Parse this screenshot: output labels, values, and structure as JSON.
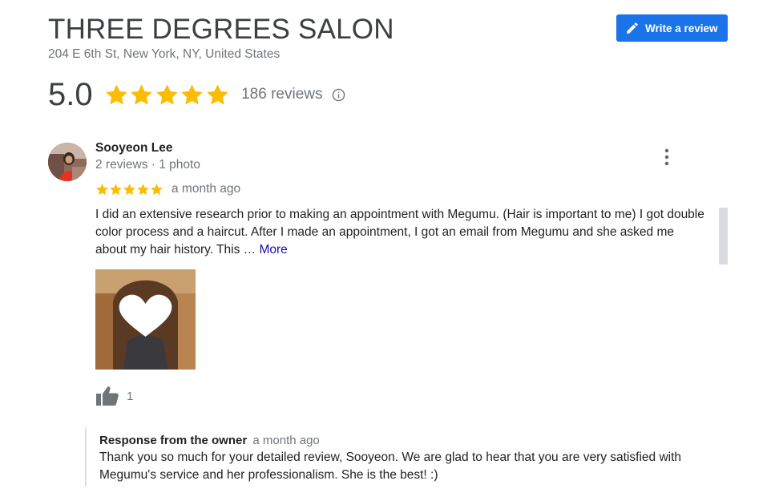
{
  "business": {
    "name": "THREE DEGREES SALON",
    "address": "204 E 6th St, New York, NY, United States",
    "rating": "5.0",
    "stars": 5,
    "reviews_label": "186 reviews"
  },
  "actions": {
    "write_review_label": "Write a review"
  },
  "colors": {
    "accent": "#1a73e8",
    "star": "#fbbc04",
    "link": "#1a0dab",
    "secondary_text": "#70757a"
  },
  "review": {
    "author": "Sooyeon Lee",
    "author_meta": "2 reviews · 1 photo",
    "stars": 5,
    "date": "a month ago",
    "text": "I did an extensive research prior to making an appointment with Megumu. (Hair is important to me) I got double color process and a haircut. After I made an appointment, I got an email from Megumu and she asked me about my hair history. This … ",
    "more_label": "More",
    "likes": "1",
    "owner_response": {
      "label": "Response from the owner",
      "date": "a month ago",
      "text": "Thank you so much for your detailed review, Sooyeon. We are glad to hear that you are very satisfied with Megumu's service and her professionalism. She is the best! :)"
    }
  },
  "icons": {
    "pencil": "pencil-icon",
    "star": "star-icon",
    "info": "info-icon",
    "more": "more-vert-icon",
    "thumb": "thumb-up-icon"
  }
}
